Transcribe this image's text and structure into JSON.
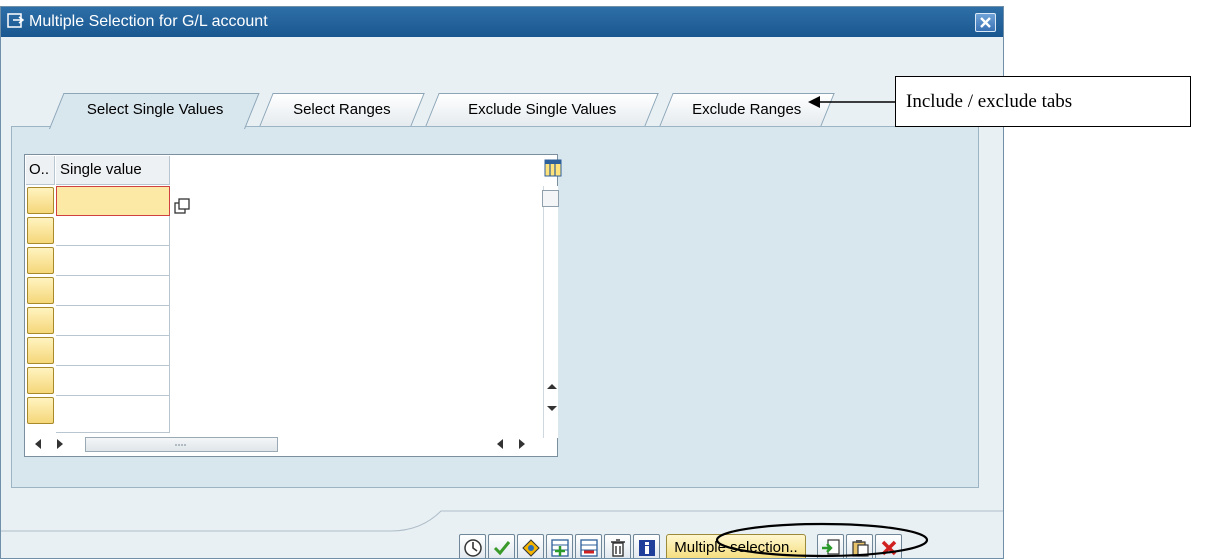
{
  "window": {
    "title": "Multiple Selection for G/L account"
  },
  "tabs": [
    {
      "label": "Select Single Values",
      "active": true
    },
    {
      "label": "Select Ranges",
      "active": false
    },
    {
      "label": "Exclude Single Values",
      "active": false
    },
    {
      "label": "Exclude Ranges",
      "active": false
    }
  ],
  "table": {
    "columns": [
      "O..",
      "Single value"
    ],
    "visible_rows": 8,
    "rows": [
      "",
      "",
      "",
      "",
      "",
      "",
      "",
      ""
    ]
  },
  "annotation": {
    "text": "Include / exclude tabs"
  },
  "toolbar": {
    "buttons": [
      "execute-icon",
      "check-icon",
      "options-icon",
      "insert-line-icon",
      "delete-line-icon",
      "delete-all-icon",
      "info-icon"
    ],
    "multiple_selection_label": "Multiple selection..",
    "right_buttons": [
      "import-icon",
      "paste-icon",
      "cancel-icon"
    ]
  },
  "colors": {
    "titlebar": "#1a5790",
    "panel": "#d8e6ee",
    "row_selector": "#f5d77a",
    "highlight_button": "#f4dc79"
  }
}
